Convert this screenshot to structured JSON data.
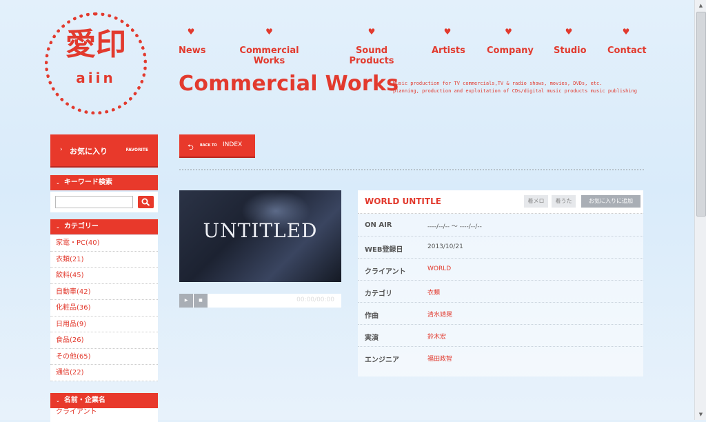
{
  "logo": {
    "kanji": "愛印",
    "romaji": "aiin"
  },
  "nav": [
    {
      "label": "News"
    },
    {
      "label": "Commercial Works"
    },
    {
      "label": "Sound Products"
    },
    {
      "label": "Artists"
    },
    {
      "label": "Company"
    },
    {
      "label": "Studio"
    },
    {
      "label": "Contact"
    }
  ],
  "heart": "♥",
  "page_title": "Commercial Works",
  "tagline": {
    "line1": "Music production for TV commercials,TV & radio shows, movies, DVDs, etc.",
    "line2": "planning, production and exploitation of CDs/digital music products music publishing"
  },
  "sidebar": {
    "favorite": {
      "label": "お気に入り",
      "sub": "FAVORITE",
      "arrow": "›"
    },
    "keyword": {
      "title": "キーワード検索",
      "placeholder": ""
    },
    "category": {
      "title": "カテゴリー",
      "items": [
        {
          "label": "家電・PC(40)"
        },
        {
          "label": "衣類(21)"
        },
        {
          "label": "飲料(45)"
        },
        {
          "label": "自動車(42)"
        },
        {
          "label": "化粧品(36)"
        },
        {
          "label": "日用品(9)"
        },
        {
          "label": "食品(26)"
        },
        {
          "label": "その他(65)"
        },
        {
          "label": "通信(22)"
        }
      ]
    },
    "names": {
      "title": "名前・企業名",
      "items": [
        {
          "label": "クライアント"
        }
      ]
    }
  },
  "back": {
    "small": "BACK TO",
    "label": "INDEX",
    "icon": "⮌"
  },
  "video": {
    "title": "UNTITLED",
    "time": "00:00/00:00",
    "play": "▶",
    "stop": "■"
  },
  "work": {
    "title": "WORLD UNTITLE",
    "buttons": {
      "melody": "着メロ",
      "uta": "着うた",
      "favorite": "お気に入りに追加"
    },
    "rows": [
      {
        "label": "ON AIR",
        "value": "----/--/-- ～ ----/--/--",
        "link": false
      },
      {
        "label": "WEB登録日",
        "value": "2013/10/21",
        "link": false
      },
      {
        "label": "クライアント",
        "value": "WORLD",
        "link": true
      },
      {
        "label": "カテゴリ",
        "value": "衣類",
        "link": true
      },
      {
        "label": "作曲",
        "value": "清水靖晃",
        "link": true
      },
      {
        "label": "実演",
        "value": "鈴木宏",
        "link": true
      },
      {
        "label": "エンジニア",
        "value": "福田政智",
        "link": true
      }
    ]
  },
  "colors": {
    "accent": "#e8392b",
    "background": "#dcecfa"
  }
}
